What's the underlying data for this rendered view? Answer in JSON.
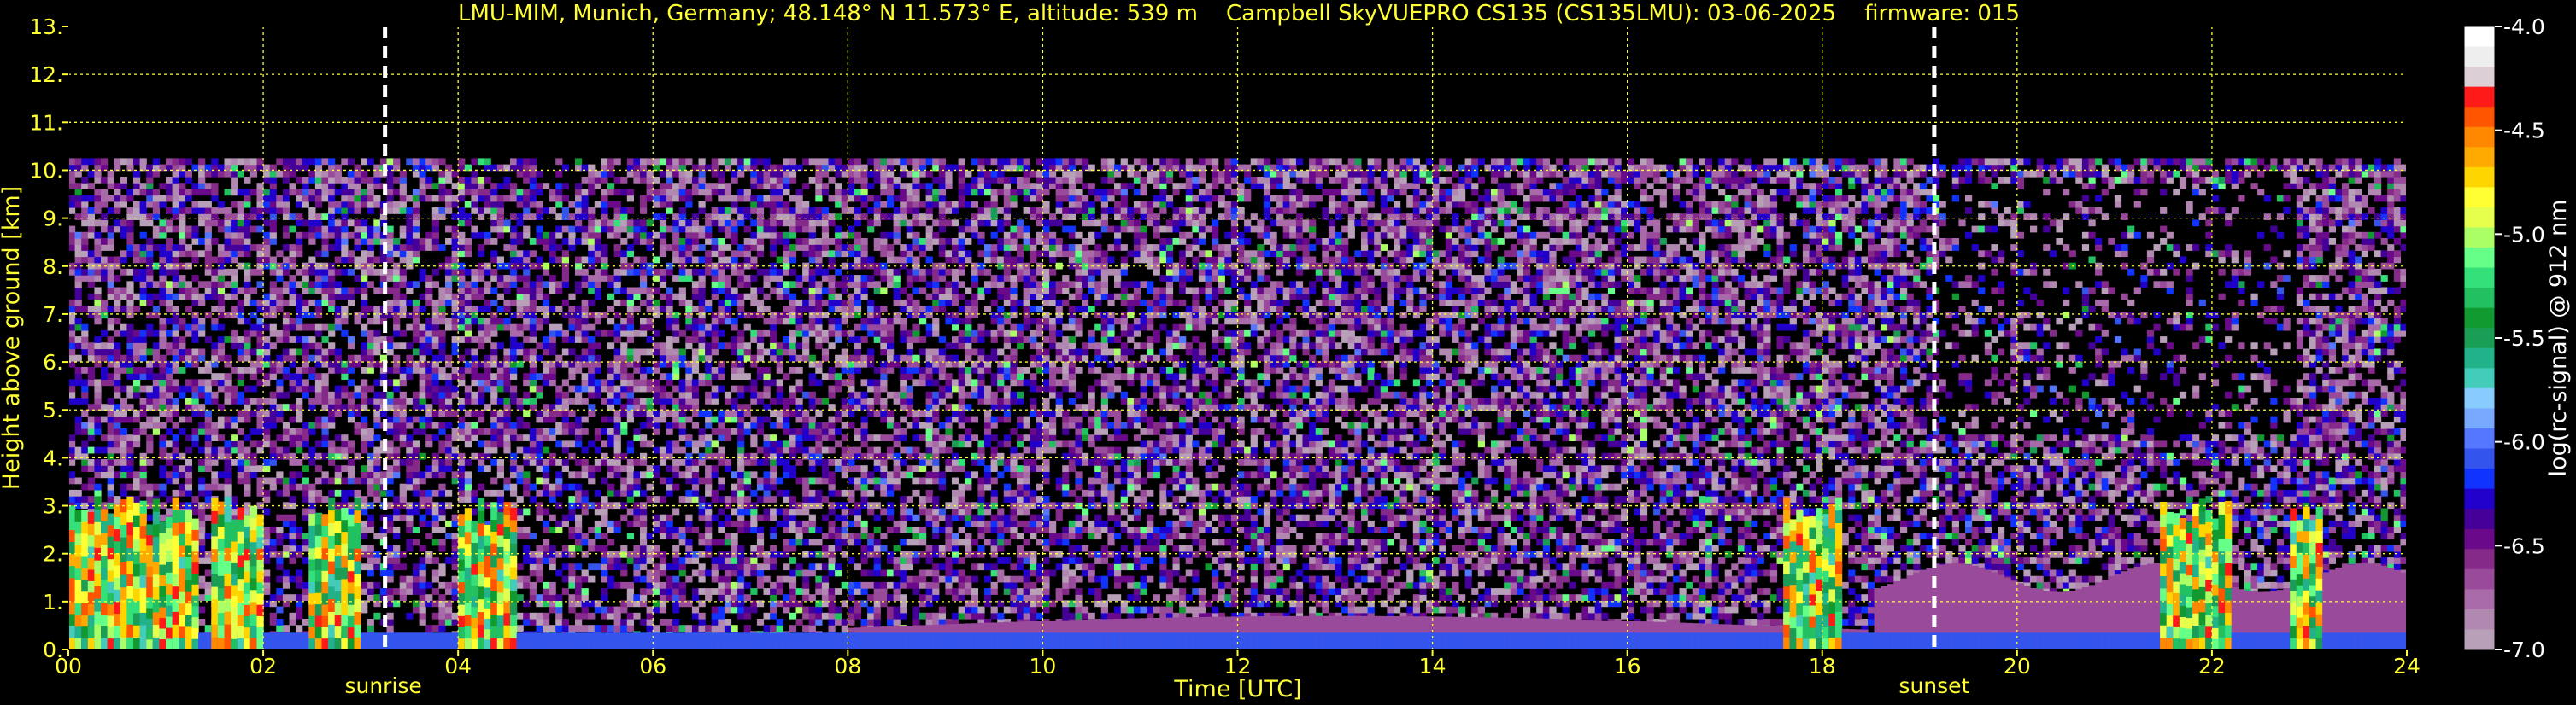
{
  "chart_data": {
    "type": "heatmap",
    "title": "LMU-MIM, Munich, Germany; 48.148° N 11.573° E, altitude: 539 m    Campbell SkyVUEPRO CS135 (CS135LMU): 03-06-2025    firmware: 015",
    "xlabel": "Time [UTC]",
    "ylabel": "Height above ground [km]",
    "xlim": [
      0,
      24
    ],
    "ylim": [
      0,
      13
    ],
    "x_ticks": [
      "00",
      "02",
      "04",
      "06",
      "08",
      "10",
      "12",
      "14",
      "16",
      "18",
      "20",
      "22",
      "24"
    ],
    "y_ticks": [
      "0.",
      "1.",
      "2.",
      "3.",
      "4.",
      "5.",
      "6.",
      "7.",
      "8.",
      "9.",
      "10.",
      "11.",
      "12.",
      "13."
    ],
    "grid": true,
    "events": [
      {
        "label": "sunrise",
        "time": 3.25
      },
      {
        "label": "sunset",
        "time": 19.15
      }
    ],
    "signal_top_km": 10.25,
    "colorbar": {
      "label": "log(rc-signal) @ 912 nm",
      "range": [
        -7.0,
        -4.0
      ],
      "ticks": [
        "-4.0",
        "-4.5",
        "-5.0",
        "-5.5",
        "-6.0",
        "-6.5",
        "-7.0"
      ],
      "colors": [
        "#ffffff",
        "#eeeeee",
        "#dccfd6",
        "#ff1a1a",
        "#ff5500",
        "#ff8800",
        "#ffaa00",
        "#ffd500",
        "#ffff33",
        "#e6ff4d",
        "#aaff66",
        "#66ff88",
        "#33e07a",
        "#22c060",
        "#109a30",
        "#1a9e55",
        "#22b28a",
        "#44ccbb",
        "#88ccff",
        "#77aaff",
        "#5577ff",
        "#3355ee",
        "#1133ff",
        "#2200cc",
        "#440099",
        "#6a0a8a",
        "#862a8a",
        "#9a4a9a",
        "#a86aa8",
        "#b088b0",
        "#b8a0b8"
      ]
    }
  }
}
